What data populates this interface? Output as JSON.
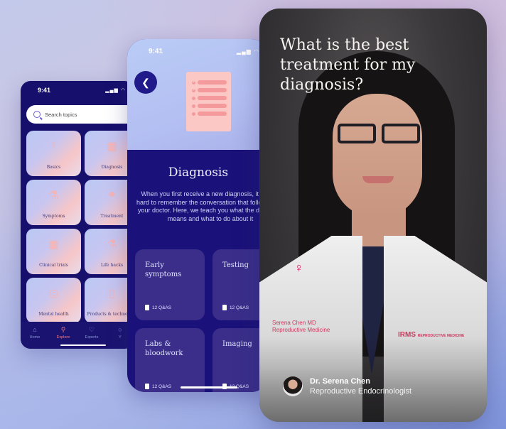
{
  "explore_screen": {
    "status_time": "9:41",
    "search_placeholder": "Search topics",
    "topics": [
      {
        "label": "Basics",
        "icon": "uterus-icon"
      },
      {
        "label": "Diagnosis",
        "icon": "blocks-icon"
      },
      {
        "label": "Symptoms",
        "icon": "lab-flask-icon"
      },
      {
        "label": "Treatment",
        "icon": "egg-icon"
      },
      {
        "label": "Clinical trials",
        "icon": "blocks-icon"
      },
      {
        "label": "Life hacks",
        "icon": "lab-flask-icon"
      },
      {
        "label": "Mental health",
        "icon": "spiral-icon"
      },
      {
        "label": "Products & technology",
        "icon": "phone-icon"
      }
    ],
    "nav": [
      {
        "label": "Home",
        "icon": "home-icon",
        "active": false
      },
      {
        "label": "Explore",
        "icon": "explore-icon",
        "active": true
      },
      {
        "label": "Experts",
        "icon": "stethoscope-icon",
        "active": false
      },
      {
        "label": "Y",
        "icon": "profile-icon",
        "active": false
      }
    ],
    "active_color": "#f47a86"
  },
  "diagnosis_screen": {
    "status_time": "9:41",
    "title": "Diagnosis",
    "description": "When you first receive a new diagnosis, it can be hard to remember the conversation that follows from your doctor. Here, we teach you what the diagnosis means and what to do about it",
    "cards": [
      {
        "title": "Early symptoms",
        "meta": "12 Q&AS"
      },
      {
        "title": "Testing",
        "meta": "12 Q&AS"
      },
      {
        "title": "Labs & bloodwork",
        "meta": "12 Q&AS"
      },
      {
        "title": "Imaging",
        "meta": "12 Q&AS"
      }
    ]
  },
  "expert_screen": {
    "question": "What is the best treatment for my diagnosis?",
    "expert_name": "Dr. Serena Chen",
    "expert_role": "Reproductive Endocrinologist",
    "coat_text_left": "Serena Chen MD\nReproductive Medicine",
    "coat_logo": "IRMS",
    "coat_logo_sub": "REPRODUCTIVE MEDICINE"
  },
  "colors": {
    "brand_navy": "#16106c",
    "accent_pink": "#f47a86",
    "card_purple": "#3a2e8a"
  }
}
